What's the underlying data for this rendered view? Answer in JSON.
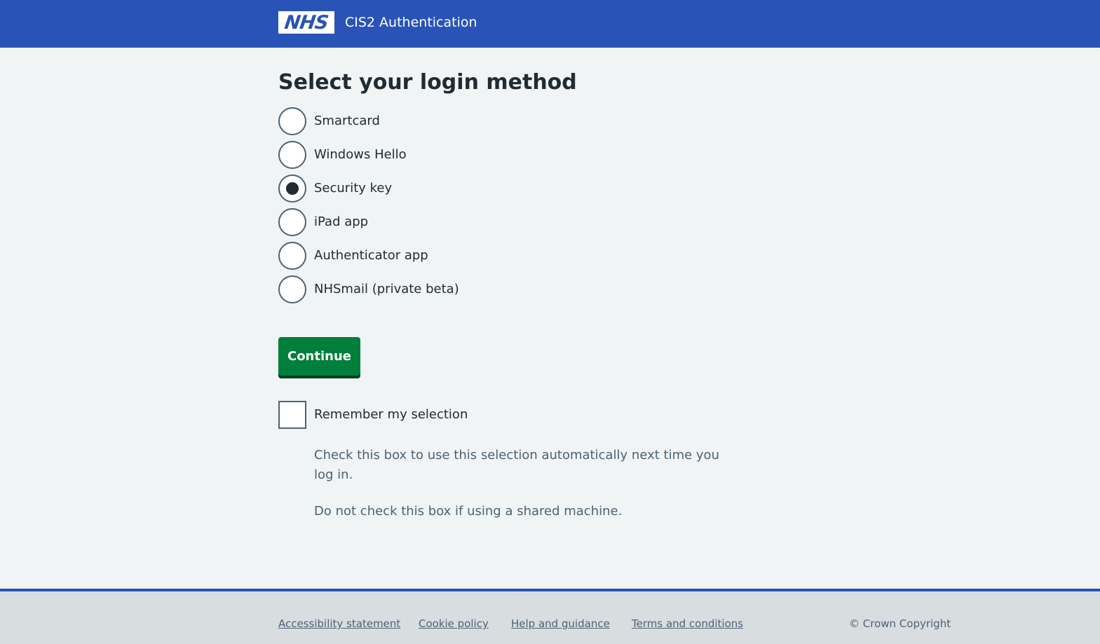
{
  "header": {
    "logo_text": "NHS",
    "service_name": "CIS2 Authentication",
    "background_color": "#2953b6"
  },
  "main": {
    "title": "Select your login method",
    "options": [
      {
        "label": "Smartcard",
        "checked": false
      },
      {
        "label": "Windows Hello",
        "checked": false
      },
      {
        "label": "Security key",
        "checked": true
      },
      {
        "label": "iPad app",
        "checked": false
      },
      {
        "label": "Authenticator app",
        "checked": false
      },
      {
        "label": "NHSmail (private beta)",
        "checked": false
      }
    ],
    "continue_label": "Continue",
    "continue_color": "#007f3b",
    "remember": {
      "label": "Remember my selection",
      "checked": false
    },
    "hint_1": "Check this box to use this selection automatically next time you log in.",
    "hint_2": "Do not check this box if using a shared machine."
  },
  "footer": {
    "links": [
      "Accessibility statement",
      "Cookie policy",
      "Help and guidance",
      "Terms and conditions"
    ],
    "copyright": "© Crown Copyright"
  }
}
